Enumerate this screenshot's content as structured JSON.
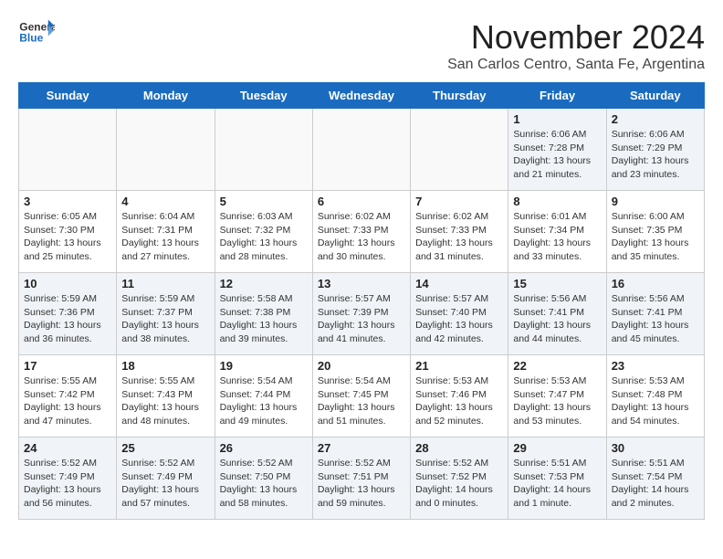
{
  "logo": {
    "general": "General",
    "blue": "Blue"
  },
  "title": "November 2024",
  "subtitle": "San Carlos Centro, Santa Fe, Argentina",
  "days_of_week": [
    "Sunday",
    "Monday",
    "Tuesday",
    "Wednesday",
    "Thursday",
    "Friday",
    "Saturday"
  ],
  "weeks": [
    [
      {
        "day": "",
        "info": ""
      },
      {
        "day": "",
        "info": ""
      },
      {
        "day": "",
        "info": ""
      },
      {
        "day": "",
        "info": ""
      },
      {
        "day": "",
        "info": ""
      },
      {
        "day": "1",
        "info": "Sunrise: 6:06 AM\nSunset: 7:28 PM\nDaylight: 13 hours\nand 21 minutes."
      },
      {
        "day": "2",
        "info": "Sunrise: 6:06 AM\nSunset: 7:29 PM\nDaylight: 13 hours\nand 23 minutes."
      }
    ],
    [
      {
        "day": "3",
        "info": "Sunrise: 6:05 AM\nSunset: 7:30 PM\nDaylight: 13 hours\nand 25 minutes."
      },
      {
        "day": "4",
        "info": "Sunrise: 6:04 AM\nSunset: 7:31 PM\nDaylight: 13 hours\nand 27 minutes."
      },
      {
        "day": "5",
        "info": "Sunrise: 6:03 AM\nSunset: 7:32 PM\nDaylight: 13 hours\nand 28 minutes."
      },
      {
        "day": "6",
        "info": "Sunrise: 6:02 AM\nSunset: 7:33 PM\nDaylight: 13 hours\nand 30 minutes."
      },
      {
        "day": "7",
        "info": "Sunrise: 6:02 AM\nSunset: 7:33 PM\nDaylight: 13 hours\nand 31 minutes."
      },
      {
        "day": "8",
        "info": "Sunrise: 6:01 AM\nSunset: 7:34 PM\nDaylight: 13 hours\nand 33 minutes."
      },
      {
        "day": "9",
        "info": "Sunrise: 6:00 AM\nSunset: 7:35 PM\nDaylight: 13 hours\nand 35 minutes."
      }
    ],
    [
      {
        "day": "10",
        "info": "Sunrise: 5:59 AM\nSunset: 7:36 PM\nDaylight: 13 hours\nand 36 minutes."
      },
      {
        "day": "11",
        "info": "Sunrise: 5:59 AM\nSunset: 7:37 PM\nDaylight: 13 hours\nand 38 minutes."
      },
      {
        "day": "12",
        "info": "Sunrise: 5:58 AM\nSunset: 7:38 PM\nDaylight: 13 hours\nand 39 minutes."
      },
      {
        "day": "13",
        "info": "Sunrise: 5:57 AM\nSunset: 7:39 PM\nDaylight: 13 hours\nand 41 minutes."
      },
      {
        "day": "14",
        "info": "Sunrise: 5:57 AM\nSunset: 7:40 PM\nDaylight: 13 hours\nand 42 minutes."
      },
      {
        "day": "15",
        "info": "Sunrise: 5:56 AM\nSunset: 7:41 PM\nDaylight: 13 hours\nand 44 minutes."
      },
      {
        "day": "16",
        "info": "Sunrise: 5:56 AM\nSunset: 7:41 PM\nDaylight: 13 hours\nand 45 minutes."
      }
    ],
    [
      {
        "day": "17",
        "info": "Sunrise: 5:55 AM\nSunset: 7:42 PM\nDaylight: 13 hours\nand 47 minutes."
      },
      {
        "day": "18",
        "info": "Sunrise: 5:55 AM\nSunset: 7:43 PM\nDaylight: 13 hours\nand 48 minutes."
      },
      {
        "day": "19",
        "info": "Sunrise: 5:54 AM\nSunset: 7:44 PM\nDaylight: 13 hours\nand 49 minutes."
      },
      {
        "day": "20",
        "info": "Sunrise: 5:54 AM\nSunset: 7:45 PM\nDaylight: 13 hours\nand 51 minutes."
      },
      {
        "day": "21",
        "info": "Sunrise: 5:53 AM\nSunset: 7:46 PM\nDaylight: 13 hours\nand 52 minutes."
      },
      {
        "day": "22",
        "info": "Sunrise: 5:53 AM\nSunset: 7:47 PM\nDaylight: 13 hours\nand 53 minutes."
      },
      {
        "day": "23",
        "info": "Sunrise: 5:53 AM\nSunset: 7:48 PM\nDaylight: 13 hours\nand 54 minutes."
      }
    ],
    [
      {
        "day": "24",
        "info": "Sunrise: 5:52 AM\nSunset: 7:49 PM\nDaylight: 13 hours\nand 56 minutes."
      },
      {
        "day": "25",
        "info": "Sunrise: 5:52 AM\nSunset: 7:49 PM\nDaylight: 13 hours\nand 57 minutes."
      },
      {
        "day": "26",
        "info": "Sunrise: 5:52 AM\nSunset: 7:50 PM\nDaylight: 13 hours\nand 58 minutes."
      },
      {
        "day": "27",
        "info": "Sunrise: 5:52 AM\nSunset: 7:51 PM\nDaylight: 13 hours\nand 59 minutes."
      },
      {
        "day": "28",
        "info": "Sunrise: 5:52 AM\nSunset: 7:52 PM\nDaylight: 14 hours\nand 0 minutes."
      },
      {
        "day": "29",
        "info": "Sunrise: 5:51 AM\nSunset: 7:53 PM\nDaylight: 14 hours\nand 1 minute."
      },
      {
        "day": "30",
        "info": "Sunrise: 5:51 AM\nSunset: 7:54 PM\nDaylight: 14 hours\nand 2 minutes."
      }
    ]
  ]
}
